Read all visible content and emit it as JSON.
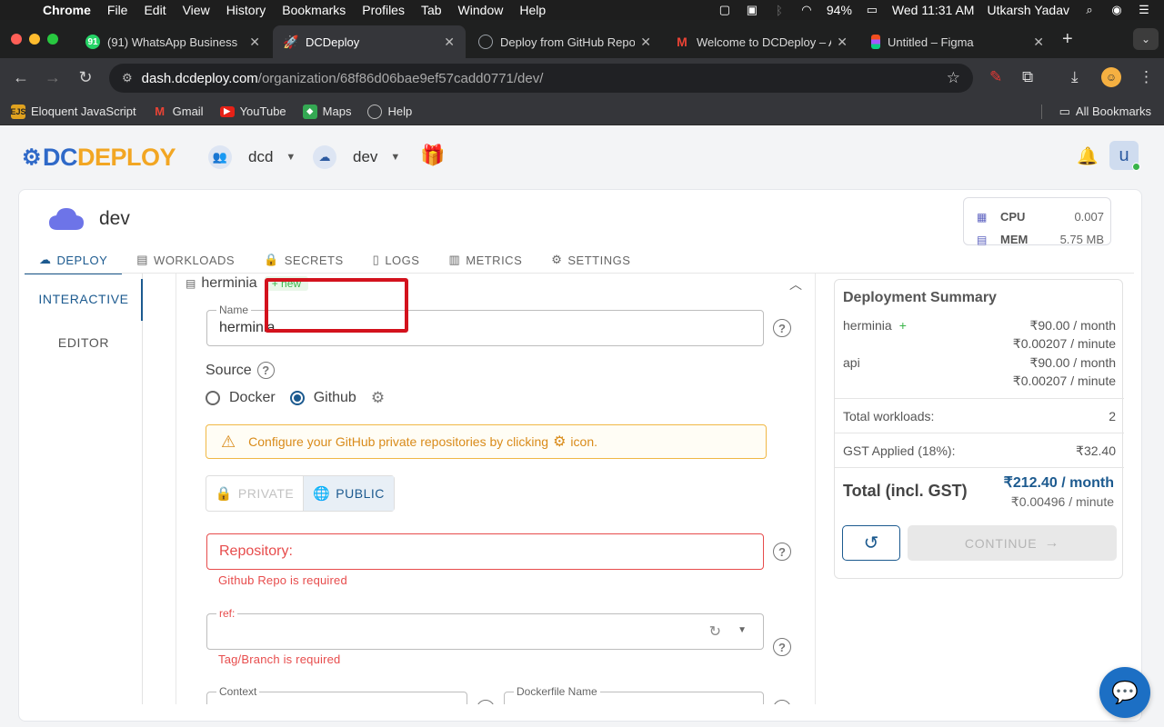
{
  "os_menu": {
    "app": "Chrome",
    "items": [
      "File",
      "Edit",
      "View",
      "History",
      "Bookmarks",
      "Profiles",
      "Tab",
      "Window",
      "Help"
    ],
    "battery": "94%",
    "datetime": "Wed 11:31 AM",
    "user": "Utkarsh Yadav"
  },
  "browser": {
    "tabs": [
      {
        "title": "(91) WhatsApp Business",
        "favicon": "whatsapp-icon",
        "color": "#25d366"
      },
      {
        "title": "DCDeploy",
        "favicon": "rocket-icon",
        "color": "#f2a623"
      },
      {
        "title": "Deploy from GitHub Repo",
        "favicon": "globe-icon",
        "color": "#9aa0a6"
      },
      {
        "title": "Welcome to DCDeploy – A",
        "favicon": "gmail-icon",
        "color": "#ea4335"
      },
      {
        "title": "Untitled – Figma",
        "favicon": "figma-icon",
        "color": "#a259ff"
      }
    ],
    "url_host": "dash.dcdeploy.com",
    "url_path": "/organization/68f86d06bae9ef57cadd0771/dev/",
    "bookmarks": [
      {
        "label": "Eloquent JavaScript",
        "icon": "ejs-icon"
      },
      {
        "label": "Gmail",
        "icon": "gmail-icon"
      },
      {
        "label": "YouTube",
        "icon": "youtube-icon"
      },
      {
        "label": "Maps",
        "icon": "maps-icon"
      },
      {
        "label": "Help",
        "icon": "globe-icon"
      }
    ],
    "all_bookmarks": "All Bookmarks"
  },
  "app": {
    "logo_dc": "DC",
    "logo_deploy": "DEPLOY",
    "org": "dcd",
    "env": "dev",
    "user_initial": "u"
  },
  "environment": {
    "name": "dev",
    "cpu_label": "CPU",
    "cpu_value": "0.007",
    "mem_label": "MEM",
    "mem_value": "5.75 MB"
  },
  "tabs": [
    "DEPLOY",
    "WORKLOADS",
    "SECRETS",
    "LOGS",
    "METRICS",
    "SETTINGS"
  ],
  "sidenav": [
    "INTERACTIVE",
    "EDITOR"
  ],
  "workload": {
    "name": "herminia",
    "badge": "+ new",
    "name_label": "Name",
    "name_value": "herminia",
    "source_label": "Source",
    "source_options": [
      "Docker",
      "Github"
    ],
    "source_selected": "Github",
    "warning_pre": "Configure your GitHub private repositories by clicking",
    "warning_post": "icon.",
    "visibility_private": "PRIVATE",
    "visibility_public": "PUBLIC",
    "repo_label": "Repository:",
    "repo_error": "Github Repo is required",
    "ref_label": "ref:",
    "ref_error": "Tag/Branch is required",
    "context_label": "Context",
    "dockerfile_label": "Dockerfile Name"
  },
  "summary": {
    "title": "Deployment Summary",
    "items": [
      {
        "name": "herminia",
        "monthly": "₹90.00 / month",
        "minute": "₹0.00207 / minute",
        "is_new": true
      },
      {
        "name": "api",
        "monthly": "₹90.00 / month",
        "minute": "₹0.00207 / minute",
        "is_new": false
      }
    ],
    "total_workloads_label": "Total workloads:",
    "total_workloads": "2",
    "gst_label": "GST Applied (18%):",
    "gst_value": "₹32.40",
    "total_label": "Total (incl. GST)",
    "total_monthly": "₹212.40 / month",
    "total_minute": "₹0.00496 / minute",
    "continue": "CONTINUE"
  }
}
